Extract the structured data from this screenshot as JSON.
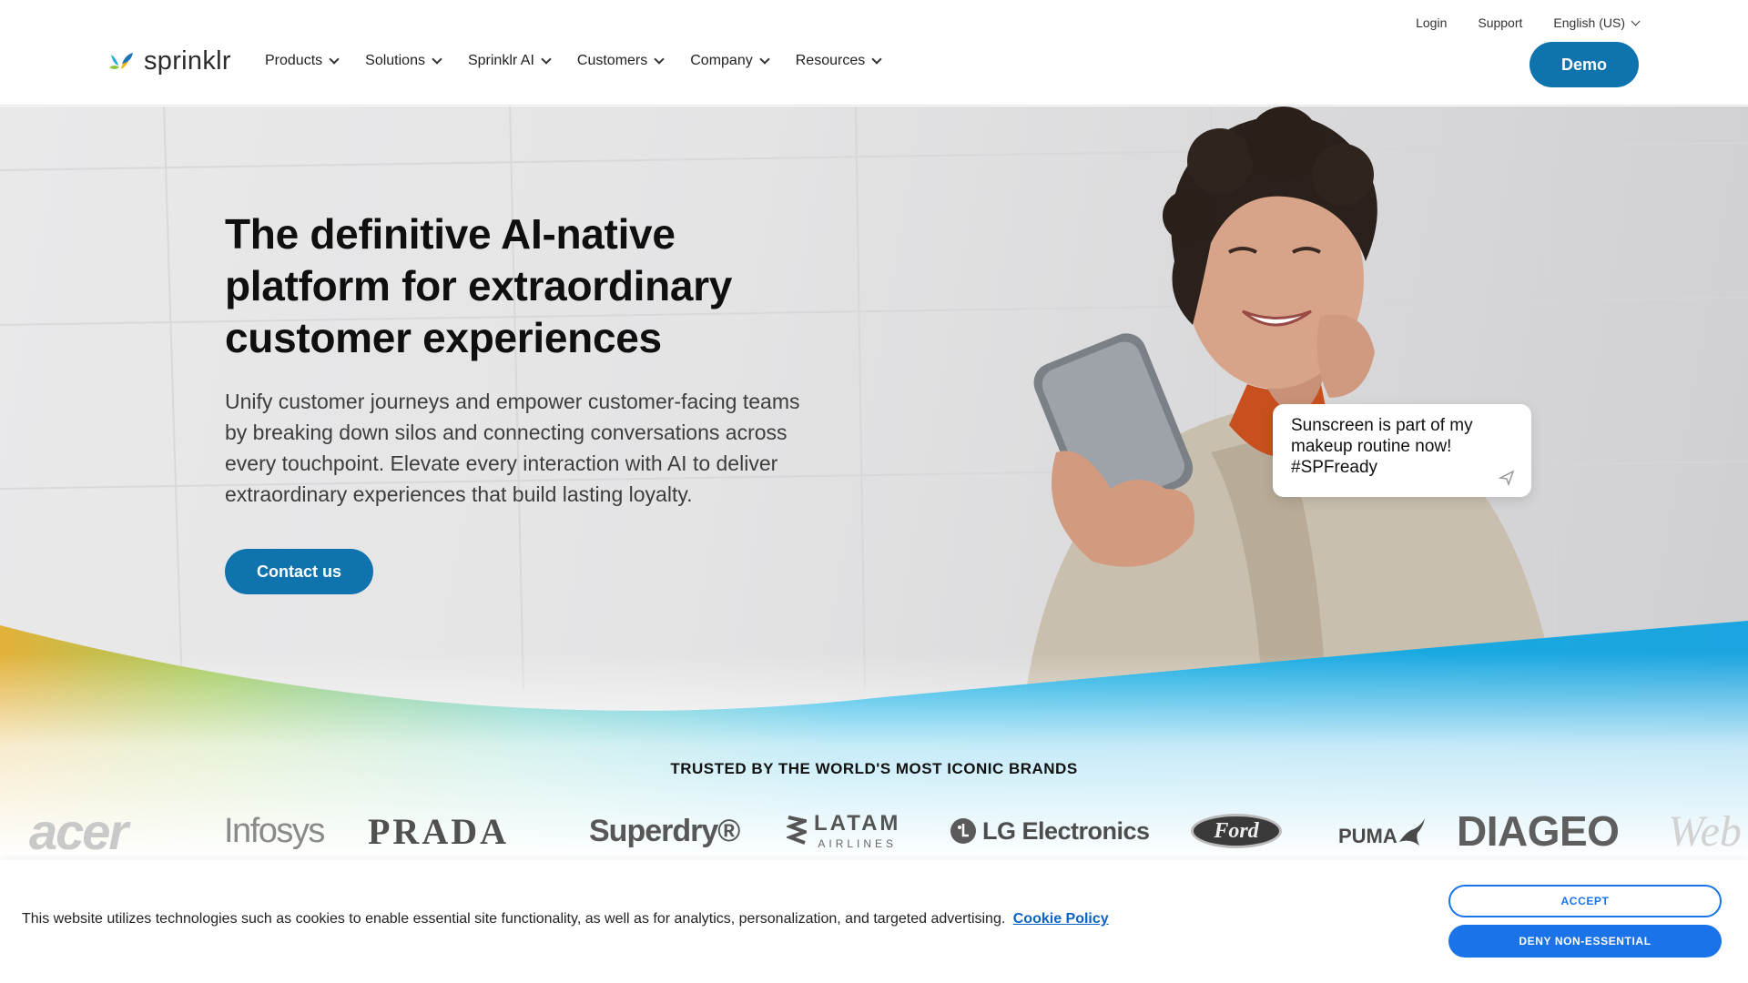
{
  "header": {
    "logo_text": "sprinklr",
    "utility": {
      "login": "Login",
      "support": "Support",
      "language": "English (US)"
    },
    "nav": [
      {
        "label": "Products"
      },
      {
        "label": "Solutions"
      },
      {
        "label": "Sprinklr AI"
      },
      {
        "label": "Customers"
      },
      {
        "label": "Company"
      },
      {
        "label": "Resources"
      }
    ],
    "demo_label": "Demo"
  },
  "hero": {
    "title": "The definitive AI-native platform for extraordinary customer experiences",
    "subtitle": "Unify customer journeys and empower customer-facing teams by breaking down silos and connecting conversations across every touchpoint. Elevate every interaction with AI to deliver extraordinary experiences that build lasting loyalty.",
    "cta_label": "Contact us",
    "bubble_text": "Sunscreen is part of my makeup routine now! #SPFready"
  },
  "brands": {
    "title": "TRUSTED BY THE WORLD'S MOST ICONIC BRANDS",
    "logos": [
      "acer",
      "Infosys",
      "PRADA",
      "Superdry®",
      "LATAM",
      "AIRLINES",
      "LG Electronics",
      "Ford",
      "PUMA",
      "DIAGEO",
      "Web"
    ]
  },
  "cookie": {
    "text": "This website utilizes technologies such as cookies to enable essential site functionality, as well as for analytics, personalization, and targeted advertising.",
    "link": "Cookie Policy",
    "accept": "ACCEPT",
    "deny": "DENY NON-ESSENTIAL"
  },
  "colors": {
    "brand_blue": "#0f73ae",
    "cookie_blue": "#1a73e8"
  }
}
